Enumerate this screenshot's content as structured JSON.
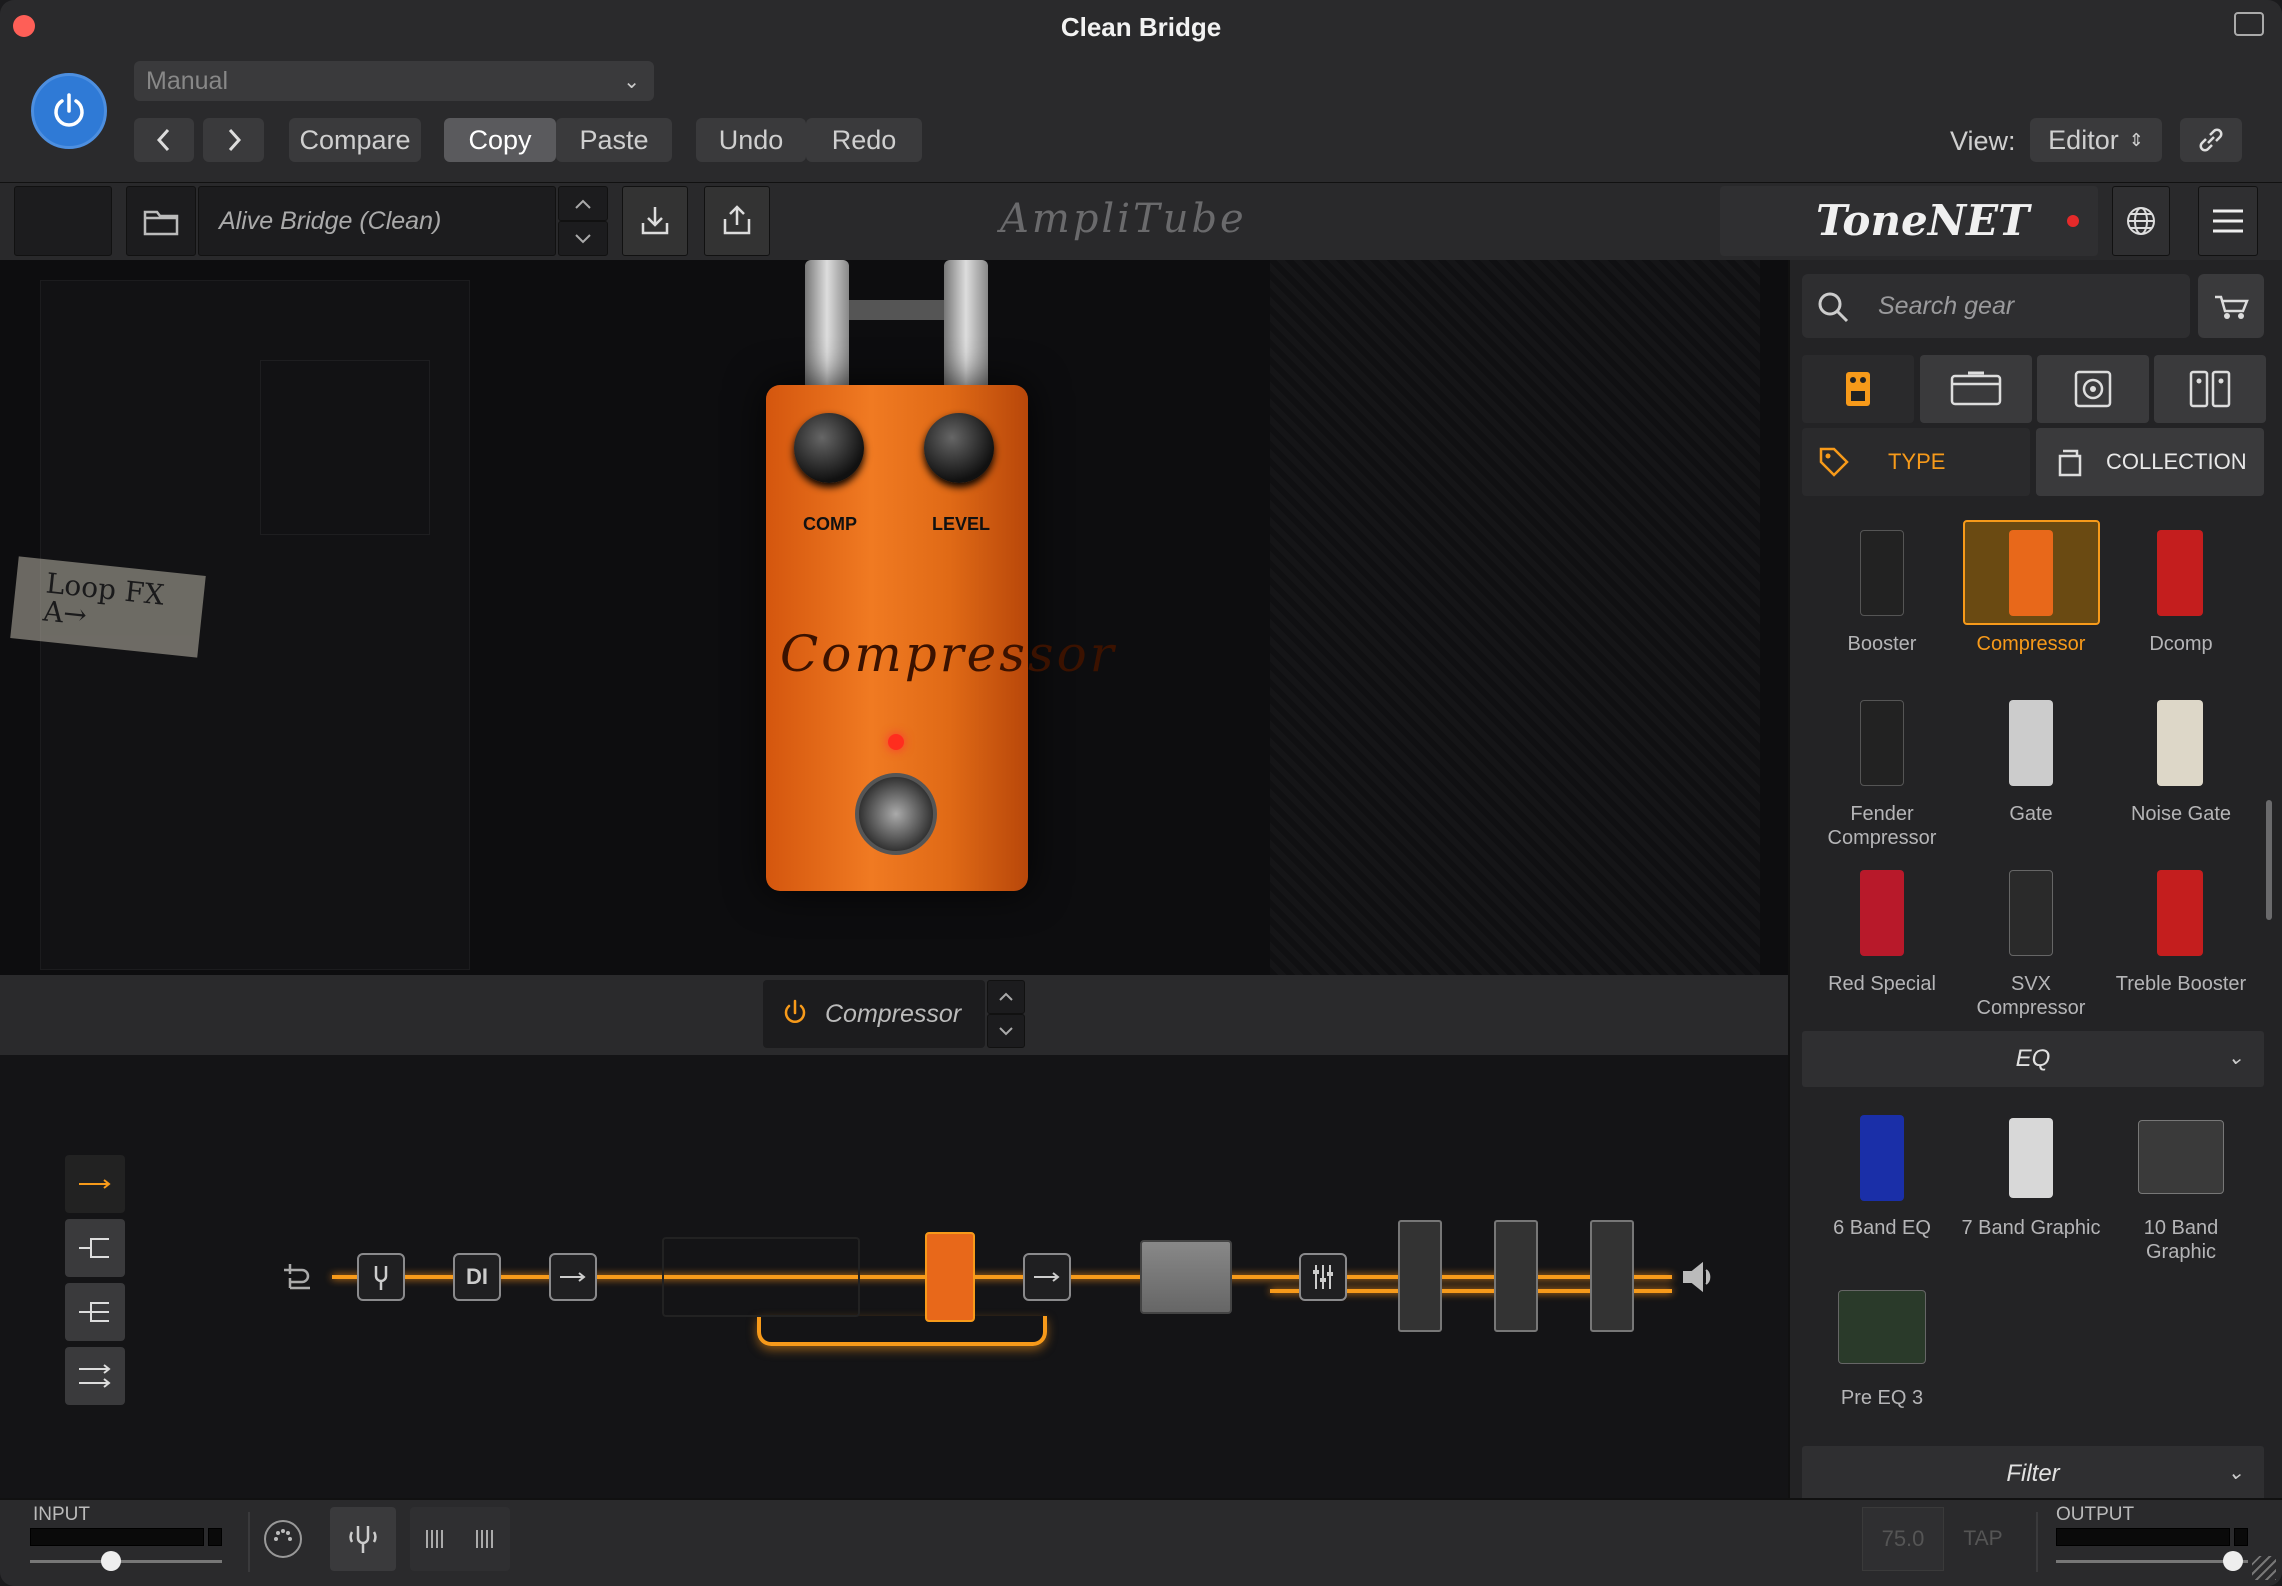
{
  "window": {
    "title": "Clean Bridge"
  },
  "host": {
    "preset_select": "Manual",
    "compare": "Compare",
    "copy": "Copy",
    "paste": "Paste",
    "undo": "Undo",
    "redo": "Redo",
    "view_label": "View:",
    "view_value": "Editor"
  },
  "toolbar": {
    "preset_name": "Alive Bridge (Clean)",
    "tonenet_logo": "ToneNET",
    "amplitube_logo": "AmpliTube"
  },
  "stage": {
    "tape_text": "Loop FX A→",
    "pedal": {
      "name": "Compressor",
      "knobs": [
        "COMP",
        "LEVEL"
      ]
    }
  },
  "selected_slot": {
    "name": "Compressor"
  },
  "chain": {
    "di_label": "DI"
  },
  "browser": {
    "search_placeholder": "Search gear",
    "filter_type": "TYPE",
    "filter_collection": "COLLECTION",
    "dynamics": [
      {
        "name": "Booster",
        "selected": false
      },
      {
        "name": "Compressor",
        "selected": true
      },
      {
        "name": "Dcomp",
        "selected": false
      },
      {
        "name": "Fender Compressor",
        "selected": false
      },
      {
        "name": "Gate",
        "selected": false
      },
      {
        "name": "Noise Gate",
        "selected": false
      },
      {
        "name": "Red Special",
        "selected": false
      },
      {
        "name": "SVX Compressor",
        "selected": false
      },
      {
        "name": "Treble Booster",
        "selected": false
      }
    ],
    "sections": {
      "eq": "EQ",
      "filter": "Filter"
    },
    "eq": [
      {
        "name": "6 Band EQ"
      },
      {
        "name": "7 Band Graphic"
      },
      {
        "name": "10 Band Graphic"
      },
      {
        "name": "Pre EQ 3"
      }
    ]
  },
  "footer": {
    "input_label": "INPUT",
    "output_label": "OUTPUT",
    "tempo": "75.0",
    "tap": "TAP",
    "input_level": 0.42,
    "output_level": 0.92
  },
  "colors": {
    "accent": "#f79a1a",
    "power_blue": "#2f7ad6",
    "pedal_orange": "#e8681a"
  }
}
